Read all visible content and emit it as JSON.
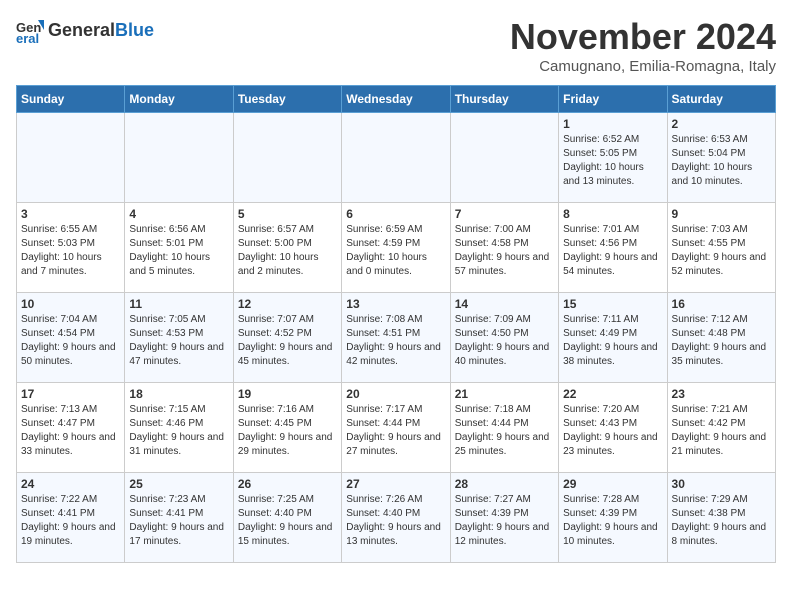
{
  "header": {
    "logo_general": "General",
    "logo_blue": "Blue",
    "month_title": "November 2024",
    "subtitle": "Camugnano, Emilia-Romagna, Italy"
  },
  "weekdays": [
    "Sunday",
    "Monday",
    "Tuesday",
    "Wednesday",
    "Thursday",
    "Friday",
    "Saturday"
  ],
  "weeks": [
    [
      {
        "day": "",
        "info": ""
      },
      {
        "day": "",
        "info": ""
      },
      {
        "day": "",
        "info": ""
      },
      {
        "day": "",
        "info": ""
      },
      {
        "day": "",
        "info": ""
      },
      {
        "day": "1",
        "info": "Sunrise: 6:52 AM\nSunset: 5:05 PM\nDaylight: 10 hours and 13 minutes."
      },
      {
        "day": "2",
        "info": "Sunrise: 6:53 AM\nSunset: 5:04 PM\nDaylight: 10 hours and 10 minutes."
      }
    ],
    [
      {
        "day": "3",
        "info": "Sunrise: 6:55 AM\nSunset: 5:03 PM\nDaylight: 10 hours and 7 minutes."
      },
      {
        "day": "4",
        "info": "Sunrise: 6:56 AM\nSunset: 5:01 PM\nDaylight: 10 hours and 5 minutes."
      },
      {
        "day": "5",
        "info": "Sunrise: 6:57 AM\nSunset: 5:00 PM\nDaylight: 10 hours and 2 minutes."
      },
      {
        "day": "6",
        "info": "Sunrise: 6:59 AM\nSunset: 4:59 PM\nDaylight: 10 hours and 0 minutes."
      },
      {
        "day": "7",
        "info": "Sunrise: 7:00 AM\nSunset: 4:58 PM\nDaylight: 9 hours and 57 minutes."
      },
      {
        "day": "8",
        "info": "Sunrise: 7:01 AM\nSunset: 4:56 PM\nDaylight: 9 hours and 54 minutes."
      },
      {
        "day": "9",
        "info": "Sunrise: 7:03 AM\nSunset: 4:55 PM\nDaylight: 9 hours and 52 minutes."
      }
    ],
    [
      {
        "day": "10",
        "info": "Sunrise: 7:04 AM\nSunset: 4:54 PM\nDaylight: 9 hours and 50 minutes."
      },
      {
        "day": "11",
        "info": "Sunrise: 7:05 AM\nSunset: 4:53 PM\nDaylight: 9 hours and 47 minutes."
      },
      {
        "day": "12",
        "info": "Sunrise: 7:07 AM\nSunset: 4:52 PM\nDaylight: 9 hours and 45 minutes."
      },
      {
        "day": "13",
        "info": "Sunrise: 7:08 AM\nSunset: 4:51 PM\nDaylight: 9 hours and 42 minutes."
      },
      {
        "day": "14",
        "info": "Sunrise: 7:09 AM\nSunset: 4:50 PM\nDaylight: 9 hours and 40 minutes."
      },
      {
        "day": "15",
        "info": "Sunrise: 7:11 AM\nSunset: 4:49 PM\nDaylight: 9 hours and 38 minutes."
      },
      {
        "day": "16",
        "info": "Sunrise: 7:12 AM\nSunset: 4:48 PM\nDaylight: 9 hours and 35 minutes."
      }
    ],
    [
      {
        "day": "17",
        "info": "Sunrise: 7:13 AM\nSunset: 4:47 PM\nDaylight: 9 hours and 33 minutes."
      },
      {
        "day": "18",
        "info": "Sunrise: 7:15 AM\nSunset: 4:46 PM\nDaylight: 9 hours and 31 minutes."
      },
      {
        "day": "19",
        "info": "Sunrise: 7:16 AM\nSunset: 4:45 PM\nDaylight: 9 hours and 29 minutes."
      },
      {
        "day": "20",
        "info": "Sunrise: 7:17 AM\nSunset: 4:44 PM\nDaylight: 9 hours and 27 minutes."
      },
      {
        "day": "21",
        "info": "Sunrise: 7:18 AM\nSunset: 4:44 PM\nDaylight: 9 hours and 25 minutes."
      },
      {
        "day": "22",
        "info": "Sunrise: 7:20 AM\nSunset: 4:43 PM\nDaylight: 9 hours and 23 minutes."
      },
      {
        "day": "23",
        "info": "Sunrise: 7:21 AM\nSunset: 4:42 PM\nDaylight: 9 hours and 21 minutes."
      }
    ],
    [
      {
        "day": "24",
        "info": "Sunrise: 7:22 AM\nSunset: 4:41 PM\nDaylight: 9 hours and 19 minutes."
      },
      {
        "day": "25",
        "info": "Sunrise: 7:23 AM\nSunset: 4:41 PM\nDaylight: 9 hours and 17 minutes."
      },
      {
        "day": "26",
        "info": "Sunrise: 7:25 AM\nSunset: 4:40 PM\nDaylight: 9 hours and 15 minutes."
      },
      {
        "day": "27",
        "info": "Sunrise: 7:26 AM\nSunset: 4:40 PM\nDaylight: 9 hours and 13 minutes."
      },
      {
        "day": "28",
        "info": "Sunrise: 7:27 AM\nSunset: 4:39 PM\nDaylight: 9 hours and 12 minutes."
      },
      {
        "day": "29",
        "info": "Sunrise: 7:28 AM\nSunset: 4:39 PM\nDaylight: 9 hours and 10 minutes."
      },
      {
        "day": "30",
        "info": "Sunrise: 7:29 AM\nSunset: 4:38 PM\nDaylight: 9 hours and 8 minutes."
      }
    ]
  ]
}
